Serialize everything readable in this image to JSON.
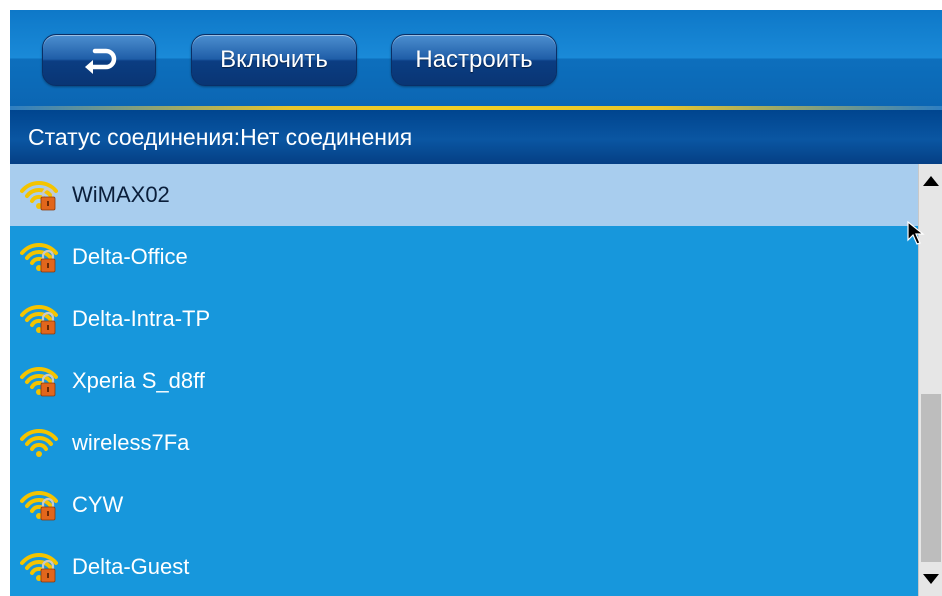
{
  "toolbar": {
    "back_icon": "return-arrow-icon",
    "enable_label": "Включить",
    "configure_label": "Настроить"
  },
  "status": {
    "label": "Статус соединения:",
    "value": "Нет соединения"
  },
  "networks": [
    {
      "ssid": "WiMAX02",
      "secured": true,
      "selected": true
    },
    {
      "ssid": "Delta-Office",
      "secured": true,
      "selected": false
    },
    {
      "ssid": "Delta-Intra-TP",
      "secured": true,
      "selected": false
    },
    {
      "ssid": "Xperia S_d8ff",
      "secured": true,
      "selected": false
    },
    {
      "ssid": "wireless7Fa",
      "secured": false,
      "selected": false
    },
    {
      "ssid": "CYW",
      "secured": true,
      "selected": false
    },
    {
      "ssid": "Delta-Guest",
      "secured": true,
      "selected": false
    }
  ],
  "colors": {
    "list_background": "#1797dc",
    "selected_row": "#a8cdee",
    "wifi_icon": "#f4c400",
    "lock_icon": "#e2661c",
    "toolbar_accent": "#f1cf24"
  },
  "icons": {
    "wifi": "wifi-signal-icon",
    "lock": "lock-icon",
    "scroll_up": "arrow-up-icon",
    "scroll_down": "arrow-down-icon",
    "cursor": "mouse-pointer-icon"
  }
}
